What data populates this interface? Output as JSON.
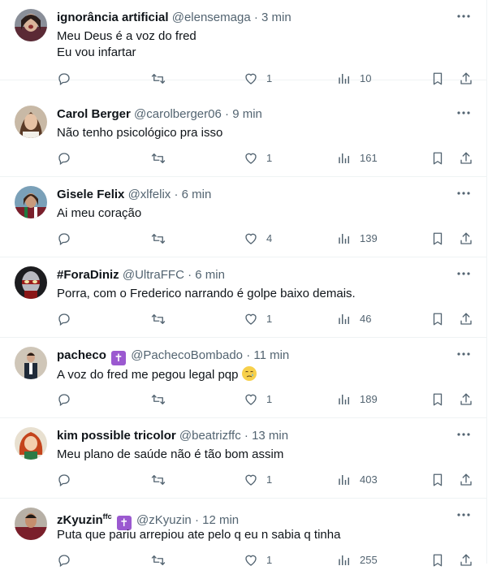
{
  "colors": {
    "text_primary": "#0f1419",
    "text_secondary": "#536471",
    "divider": "#eff3f4",
    "badge_purple": "#9b59d0"
  },
  "tweets": [
    {
      "display_name": "ignorância artificial",
      "handle": "@elensemaga",
      "time": "3 min",
      "lines": [
        "Meu Deus é a voz do fred",
        "Eu vou infartar"
      ],
      "replies": "",
      "retweets": "",
      "likes": "1",
      "views": "10"
    },
    {
      "display_name": "Carol Berger",
      "handle": "@carolberger06",
      "time": "9 min",
      "lines": [
        "Não tenho psicológico pra isso"
      ],
      "replies": "",
      "retweets": "",
      "likes": "1",
      "views": "161"
    },
    {
      "display_name": "Gisele Felix",
      "handle": "@xlfelix",
      "time": "6 min",
      "lines": [
        "Ai meu coração"
      ],
      "replies": "",
      "retweets": "",
      "likes": "4",
      "views": "139"
    },
    {
      "display_name": "#ForaDiniz",
      "handle": "@UltraFFC",
      "time": "6 min",
      "lines": [
        "Porra, com o Frederico narrando é golpe baixo demais."
      ],
      "replies": "",
      "retweets": "",
      "likes": "1",
      "views": "46"
    },
    {
      "display_name": "pacheco",
      "badge": "✝",
      "handle": "@PachecoBombado",
      "time": "11 min",
      "lines": [
        "A voz do fred me pegou legal pqp"
      ],
      "emoji": "crying-face-emoji",
      "replies": "",
      "retweets": "",
      "likes": "1",
      "views": "189"
    },
    {
      "display_name": "kim possible tricolor",
      "handle": "@beatrizffc",
      "time": "13 min",
      "lines": [
        "Meu plano de saúde não é tão bom assim"
      ],
      "replies": "",
      "retweets": "",
      "likes": "1",
      "views": "403"
    },
    {
      "display_name": "zKyuzin",
      "name_sup": "ffc",
      "badge": "✝",
      "handle": "@zKyuzin",
      "time": "12 min",
      "lines": [
        "Puta que pariu arrepiou ate pelo q eu n sabia q tinha"
      ],
      "replies": "",
      "retweets": "",
      "likes": "1",
      "views": "255"
    }
  ],
  "separator": "·",
  "icons": {
    "more": "more-icon",
    "reply": "reply-icon",
    "retweet": "retweet-icon",
    "like": "heart-icon",
    "views": "views-icon",
    "bookmark": "bookmark-icon",
    "share": "share-icon"
  }
}
